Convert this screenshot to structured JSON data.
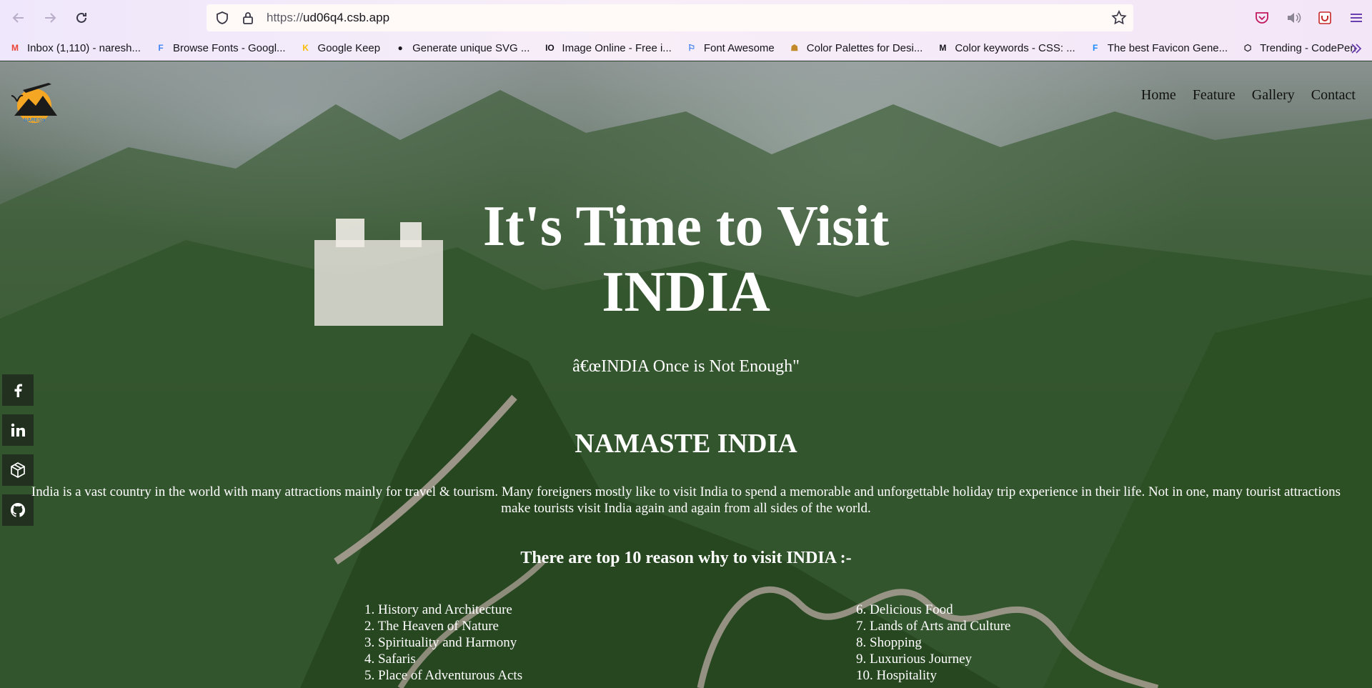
{
  "browser": {
    "url_prefix": "https://",
    "url_host": "ud06q4.csb.app",
    "bookmarks": [
      {
        "label": "Inbox (1,110) - naresh...",
        "icon": "gmail-icon",
        "color": "#ea4335",
        "glyph": "M"
      },
      {
        "label": "Browse Fonts - Googl...",
        "icon": "google-fonts-icon",
        "color": "#4285f4",
        "glyph": "F"
      },
      {
        "label": "Google Keep",
        "icon": "google-keep-icon",
        "color": "#fbbc04",
        "glyph": "K"
      },
      {
        "label": "Generate unique SVG ...",
        "icon": "circle-icon",
        "color": "#15141a",
        "glyph": "●"
      },
      {
        "label": "Image Online - Free i...",
        "icon": "io-icon",
        "color": "#15141a",
        "glyph": "IO"
      },
      {
        "label": "Font Awesome",
        "icon": "flag-icon",
        "color": "#1f6feb",
        "glyph": "⚐"
      },
      {
        "label": "Color Palettes for Desi...",
        "icon": "palette-icon",
        "color": "#c38a2b",
        "glyph": "☗"
      },
      {
        "label": "Color keywords - CSS: ...",
        "icon": "mdn-icon",
        "color": "#15141a",
        "glyph": "M"
      },
      {
        "label": "The best Favicon Gene...",
        "icon": "favicon-icon",
        "color": "#1b8cff",
        "glyph": "F"
      },
      {
        "label": "Trending - CodePen",
        "icon": "codepen-icon",
        "color": "#15141a",
        "glyph": "⬡"
      }
    ]
  },
  "site": {
    "logo_text": "NARESH",
    "nav": [
      "Home",
      "Feature",
      "Gallery",
      "Contact"
    ],
    "social": [
      "facebook-icon",
      "linkedin-icon",
      "codesandbox-icon",
      "github-icon"
    ],
    "hero_line1": "It's Time to Visit",
    "hero_line2": "INDIA",
    "tagline": "â€œINDIA Once is Not Enough\"",
    "heading": "NAMASTE INDIA",
    "intro": "India is a vast country in the world with many attractions mainly for travel & tourism. Many foreigners mostly like to visit India to spend a memorable and unforgettable holiday trip experience in their life. Not in one, many tourist attractions make tourists visit India again and again from all sides of the world.",
    "reasons_title": "There are top 10 reason why to visit INDIA :-",
    "reasons_left": [
      "1. History and Architecture",
      "2. The Heaven of Nature",
      "3. Spirituality and Harmony",
      "4. Safaris",
      "5. Place of Adventurous Acts"
    ],
    "reasons_right": [
      "6. Delicious Food",
      "7. Lands of Arts and Culture",
      "8. Shopping",
      "9. Luxurious Journey",
      "10. Hospitality"
    ]
  }
}
